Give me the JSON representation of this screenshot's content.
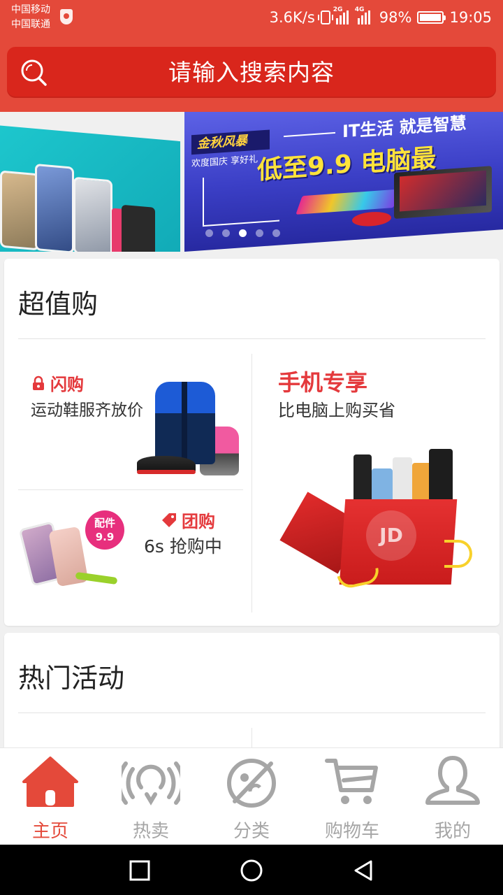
{
  "status_bar": {
    "carrier1": "中国移动",
    "carrier2": "中国联通",
    "speed": "3.6K/s",
    "net1": "2G",
    "net2": "4G",
    "battery": "98%",
    "battery_level": 0.98,
    "time": "19:05"
  },
  "search": {
    "placeholder": "请输入搜索内容",
    "icon": "search-icon"
  },
  "banner": {
    "tag": "金秋风暴",
    "sub": "欢度国庆 享好礼",
    "headline": "IT生活  就是智慧",
    "promo": "低至9.9 电脑最",
    "dots": 5,
    "active_dot": 3
  },
  "super_deal": {
    "title": "超值购",
    "flash": {
      "title": "闪购",
      "subtitle": "运动鞋服齐放价",
      "icon": "lock-icon"
    },
    "group": {
      "title": "团购",
      "subtitle": "6s 抢购中",
      "icon": "tag-icon",
      "badge_line1": "配件",
      "badge_line2": "9.9"
    },
    "mobile": {
      "title": "手机专享",
      "subtitle": "比电脑上购买省",
      "box_logo": "JD"
    }
  },
  "hot_activity": {
    "title": "热门活动"
  },
  "tabbar": {
    "items": [
      {
        "label": "主页",
        "icon": "home-icon",
        "active": true
      },
      {
        "label": "热卖",
        "icon": "hot-sale-icon",
        "active": false
      },
      {
        "label": "分类",
        "icon": "category-icon",
        "active": false
      },
      {
        "label": "购物车",
        "icon": "cart-icon",
        "active": false
      },
      {
        "label": "我的",
        "icon": "profile-icon",
        "active": false
      }
    ]
  },
  "colors": {
    "brand": "#e4493a",
    "search_bg": "#d9261c",
    "accent_red": "#e4393c",
    "inactive": "#a6a6a6"
  }
}
